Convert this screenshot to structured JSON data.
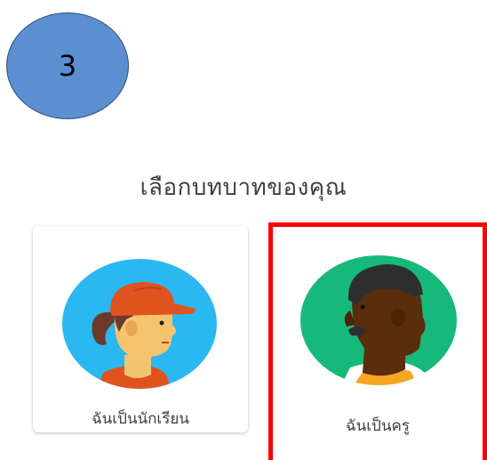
{
  "step_badge": {
    "number": "3",
    "color": "#5b8fd1"
  },
  "heading": "เลือกบทบาทของคุณ",
  "roles": [
    {
      "label": "ฉันเป็นนักเรียน",
      "icon": "student-avatar-icon",
      "avatar_bg": "#2ab8f0",
      "selected": false
    },
    {
      "label": "ฉันเป็นครู",
      "icon": "teacher-avatar-icon",
      "avatar_bg": "#17b97a",
      "selected": true,
      "highlight_color": "#ff0000"
    }
  ]
}
